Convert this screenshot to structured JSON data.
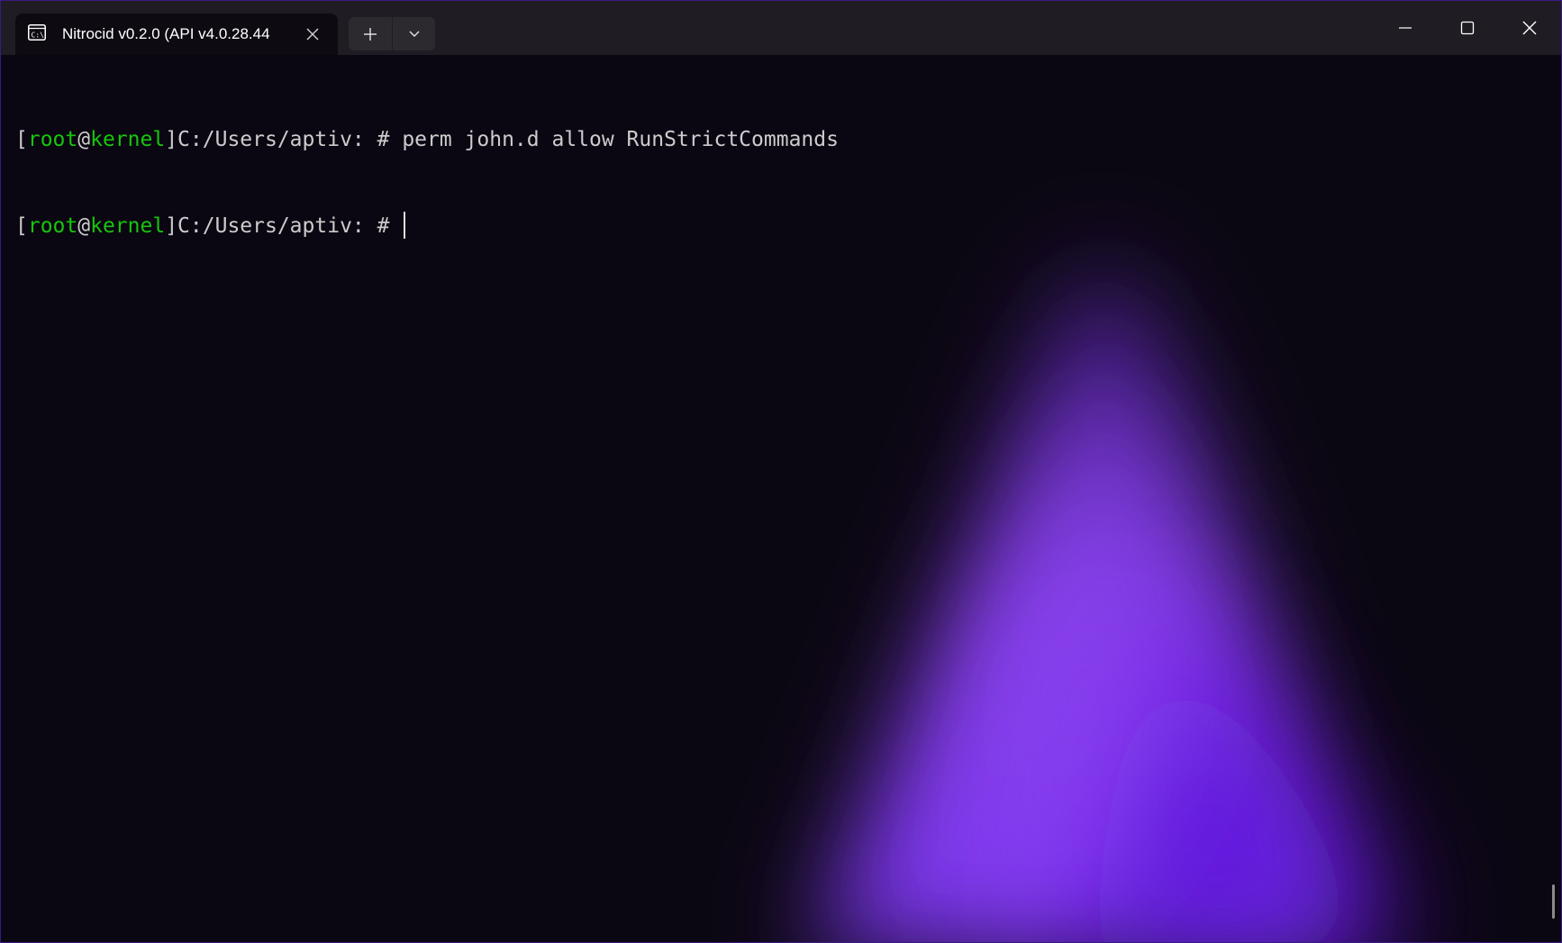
{
  "tab": {
    "title": "Nitrocid v0.2.0 (API v4.0.28.44",
    "icon": "console-icon"
  },
  "tab_actions": {
    "new_tab_icon": "plus-icon",
    "dropdown_icon": "chevron-down-icon"
  },
  "window_controls": {
    "minimize_icon": "minimize-icon",
    "maximize_icon": "maximize-icon",
    "close_icon": "close-icon"
  },
  "terminal": {
    "lines": [
      {
        "bracket_open": "[",
        "user": "root",
        "at": "@",
        "host": "kernel",
        "path": "]C:/Users/aptiv: # ",
        "command": "perm john.d allow RunStrictCommands"
      },
      {
        "bracket_open": "[",
        "user": "root",
        "at": "@",
        "host": "kernel",
        "path": "]C:/Users/aptiv: # ",
        "command": ""
      }
    ]
  },
  "colors": {
    "prompt_green": "#16c60c",
    "text": "#cccccc",
    "background": "#0b0712",
    "glow": "#8a3ff0",
    "titlebar": "#1f1c23"
  }
}
